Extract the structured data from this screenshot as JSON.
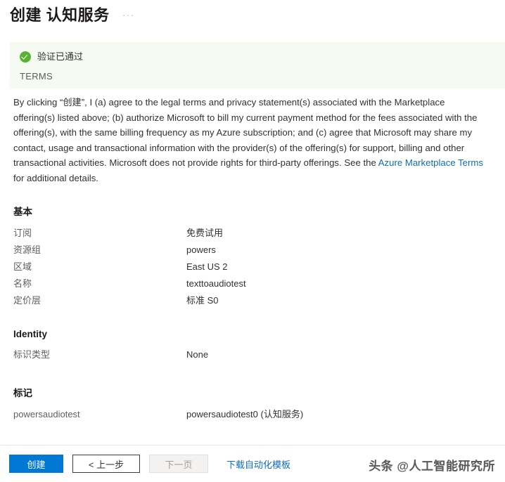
{
  "header": {
    "title": "创建 认知服务",
    "more_label": "···"
  },
  "validation": {
    "icon": "check-circle-icon",
    "status_text": "验证已通过",
    "terms_label": "TERMS",
    "banner_color": "#f6fbf1",
    "success_color": "#5ab034"
  },
  "terms": {
    "part1": "By clicking “创建”, I (a) agree to the legal terms and privacy statement(s) associated with the Marketplace offering(s) listed above; (b) authorize Microsoft to bill my current payment method for the fees associated with the offering(s), with the same billing frequency as my Azure subscription; and (c) agree that Microsoft may share my contact, usage and transactional information with the provider(s) of the offering(s) for support, billing and other transactional activities. Microsoft does not provide rights for third-party offerings. See the ",
    "link_text": "Azure Marketplace Terms",
    "part2": " for additional details.",
    "link_color": "#0f6cbd"
  },
  "sections": {
    "basics": {
      "title": "基本",
      "rows": [
        {
          "key": "订阅",
          "value": "免费试用"
        },
        {
          "key": "资源组",
          "value": "powers"
        },
        {
          "key": "区域",
          "value": "East US 2"
        },
        {
          "key": "名称",
          "value": "texttoaudiotest"
        },
        {
          "key": "定价层",
          "value": "标准 S0"
        }
      ]
    },
    "identity": {
      "title": "Identity",
      "rows": [
        {
          "key": "标识类型",
          "value": "None"
        }
      ]
    },
    "tags": {
      "title": "标记",
      "rows": [
        {
          "key": "powersaudiotest",
          "value": "powersaudiotest0 (认知服务)"
        }
      ]
    }
  },
  "command_bar": {
    "create_label": "创建",
    "previous_label": "< 上一步",
    "next_label": "下一页",
    "download_template_label": "下载自动化模板",
    "primary_color": "#0078d4"
  },
  "watermark": {
    "text": "头条 @人工智能研究所"
  }
}
